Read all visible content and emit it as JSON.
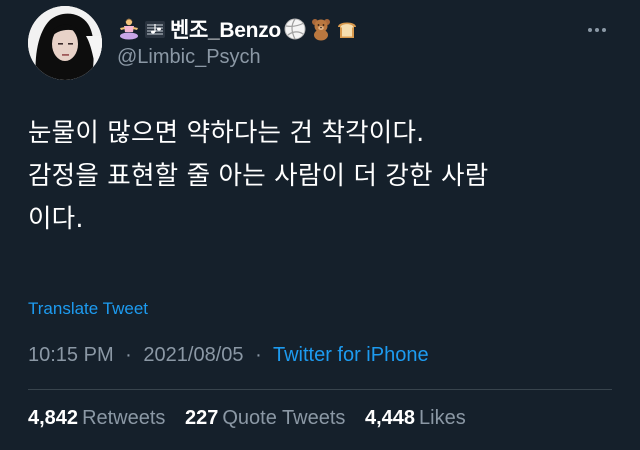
{
  "tweet": {
    "author": {
      "display_name": "벤조_Benzo",
      "handle": "@Limbic_Psych",
      "name_prefix_icons": [
        "meditating-person-emoji",
        "music-staff-emoji"
      ],
      "name_suffix_icons": [
        "volleyball-emoji",
        "teddy-bear-emoji",
        "bread-emoji"
      ]
    },
    "text_lines": [
      "눈물이 많으면 약하다는 건 착각이다.",
      "감정을 표현할 줄 아는 사람이 더 강한 사람",
      "이다."
    ],
    "translate_label": "Translate Tweet",
    "time": "10:15 PM",
    "date": "2021/08/05",
    "separator": "·",
    "source": "Twitter for iPhone",
    "stats": {
      "retweets": {
        "count": "4,842",
        "label": "Retweets"
      },
      "quote_tweets": {
        "count": "227",
        "label": "Quote Tweets"
      },
      "likes": {
        "count": "4,448",
        "label": "Likes"
      }
    }
  },
  "colors": {
    "background": "#15202b",
    "text_primary": "#ffffff",
    "text_secondary": "#8b98a5",
    "link": "#1d9bf0",
    "divider": "#38444d"
  }
}
